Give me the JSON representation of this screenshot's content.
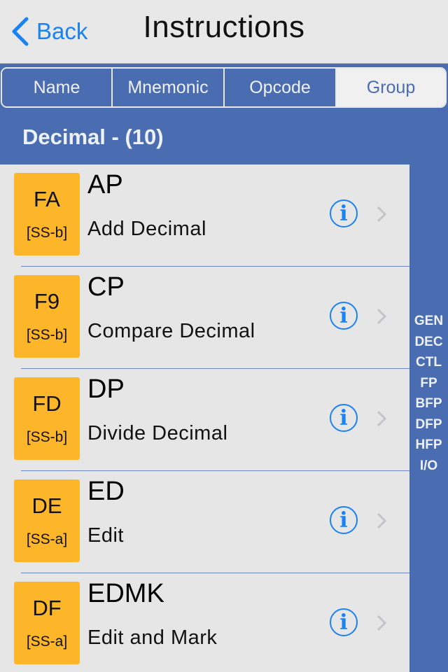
{
  "navbar": {
    "back_label": "Back",
    "title": "Instructions"
  },
  "segments": [
    {
      "label": "Name",
      "selected": false
    },
    {
      "label": "Mnemonic",
      "selected": false
    },
    {
      "label": "Opcode",
      "selected": false
    },
    {
      "label": "Group",
      "selected": true
    }
  ],
  "section": {
    "title": "Decimal - (10)"
  },
  "rows": [
    {
      "opcode": "FA",
      "format": "[SS-b]",
      "mnemonic": "AP",
      "description": "Add Decimal"
    },
    {
      "opcode": "F9",
      "format": "[SS-b]",
      "mnemonic": "CP",
      "description": "Compare Decimal"
    },
    {
      "opcode": "FD",
      "format": "[SS-b]",
      "mnemonic": "DP",
      "description": "Divide Decimal"
    },
    {
      "opcode": "DE",
      "format": "[SS-a]",
      "mnemonic": "ED",
      "description": "Edit"
    },
    {
      "opcode": "DF",
      "format": "[SS-a]",
      "mnemonic": "EDMK",
      "description": "Edit and Mark"
    }
  ],
  "index": [
    "GEN",
    "DEC",
    "CTL",
    "FP",
    "BFP",
    "DFP",
    "HFP",
    "I/O"
  ],
  "icons": {
    "back": "chevron-left-icon",
    "info": "info-circle-icon",
    "disclosure": "chevron-right-icon"
  },
  "colors": {
    "accent": "#1a82f2",
    "header_blue": "#4a6cb0",
    "opcode_badge": "#fdb62a",
    "list_bg": "#e6e6e6"
  }
}
